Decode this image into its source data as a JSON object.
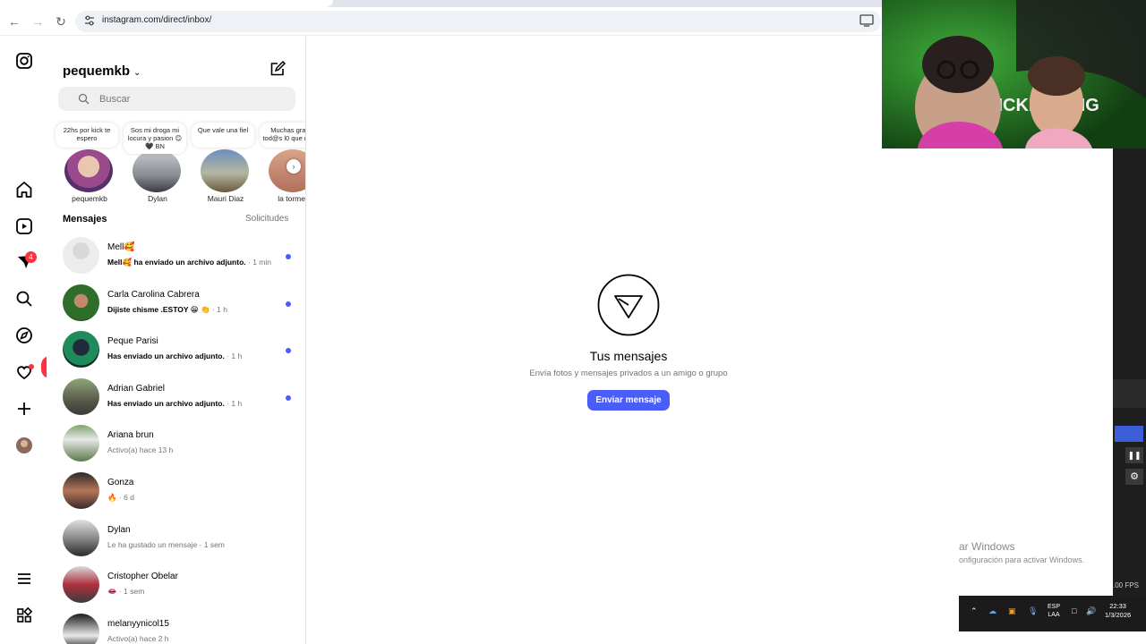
{
  "browser": {
    "url": "instagram.com/direct/inbox/"
  },
  "inbox": {
    "username": "pequemkb",
    "search_placeholder": "Buscar",
    "notes": [
      {
        "text": "22hs por kick te espero",
        "name": "pequemkb"
      },
      {
        "text": "Sos mi droga mi locura y pasion 😊🖤 BN",
        "name": "Dylan"
      },
      {
        "text": "Que vale una fiel",
        "name": "Mauri Diaz"
      },
      {
        "text": "Muchas gra a tod@s l0 que me...",
        "name": "la tormen"
      }
    ],
    "section_title": "Mensajes",
    "requests_label": "Solicitudes",
    "threads": [
      {
        "name": "Mell🥰",
        "message": "Mell🥰 ha enviado un archivo adjunto.",
        "time": " · 1 min",
        "unread": true
      },
      {
        "name": "Carla Carolina Cabrera",
        "message": "Dijiste chisme .ESTOY 😁 👏",
        "time": " · 1 h",
        "unread": true
      },
      {
        "name": "Peque Parisi",
        "message": "Has enviado un archivo adjunto.",
        "time": " · 1 h",
        "unread": true
      },
      {
        "name": "Adrian Gabriel",
        "message": "Has enviado un archivo adjunto.",
        "time": " · 1 h",
        "unread": true
      },
      {
        "name": "Ariana brun",
        "message": "Activo(a) hace 13 h",
        "time": "",
        "unread": false
      },
      {
        "name": "Gonza",
        "message": "🔥",
        "time": " · 6 d",
        "unread": false
      },
      {
        "name": "Dylan",
        "message": "Le ha gustado un mensaje",
        "time": " · 1 sem",
        "unread": false
      },
      {
        "name": "Cristopher Obelar",
        "message": "👄",
        "time": " · 1 sem",
        "unread": false
      },
      {
        "name": "melanyynicol15",
        "message": "Activo(a) hace 2 h",
        "time": "",
        "unread": false
      }
    ]
  },
  "rail": {
    "messages_badge": "4",
    "notifications_count": "1"
  },
  "main": {
    "title": "Tus mensajes",
    "subtitle": "Envía fotos y mensajes privados a un amigo o grupo",
    "button": "Enviar mensaje"
  },
  "overlay": {
    "watermark_line1": "ar Windows",
    "watermark_line2": "onfiguración para activar Windows.",
    "fps": ".00 FPS",
    "lang_top": "ESP",
    "lang_bottom": "LAA",
    "clock_time": "22:33",
    "clock_date": "1/3/2026",
    "cam_text": "KICKBOXING"
  },
  "colors": {
    "accent": "#4a5df9",
    "notification": "#ff3040",
    "muted_text": "#737373"
  }
}
